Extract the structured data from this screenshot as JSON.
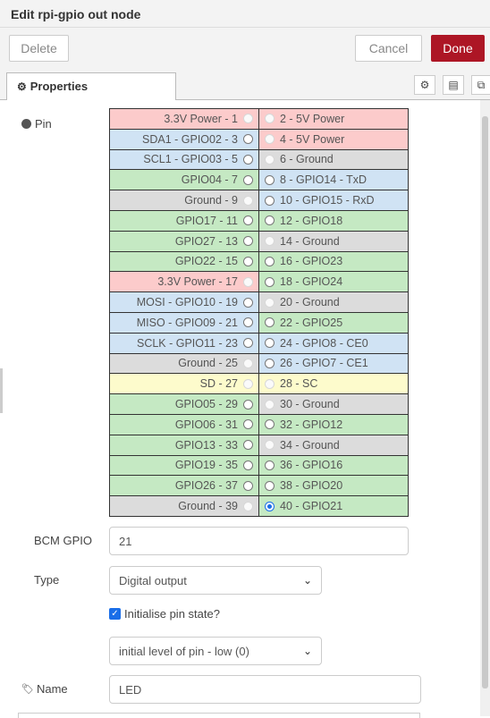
{
  "header": {
    "title": "Edit rpi-gpio out node"
  },
  "toolbar": {
    "delete_label": "Delete",
    "cancel_label": "Cancel",
    "done_label": "Done",
    "done_color": "#ad1625"
  },
  "tabs": {
    "properties_label": "Properties",
    "icons": [
      "gear-icon",
      "description-icon",
      "appearance-icon"
    ]
  },
  "form": {
    "pin_label": "Pin",
    "bcm_label": "BCM GPIO",
    "bcm_value": "21",
    "type_label": "Type",
    "type_value": "Digital output",
    "init_label": "Initialise pin state?",
    "init_checked": true,
    "level_value": "initial level of pin - low (0)",
    "name_label": "Name",
    "name_value": "LED"
  },
  "pins": [
    {
      "left": "3.3V Power - 1",
      "left_type": "power",
      "left_enabled": false,
      "right": "2 - 5V Power",
      "right_type": "power",
      "right_enabled": false
    },
    {
      "left": "SDA1 - GPIO02 - 3",
      "left_type": "i2c",
      "left_enabled": true,
      "right": "4 - 5V Power",
      "right_type": "power",
      "right_enabled": false
    },
    {
      "left": "SCL1 - GPIO03 - 5",
      "left_type": "i2c",
      "left_enabled": true,
      "right": "6 - Ground",
      "right_type": "ground",
      "right_enabled": false
    },
    {
      "left": "GPIO04 - 7",
      "left_type": "gpio",
      "left_enabled": true,
      "right": "8 - GPIO14 - TxD",
      "right_type": "uart",
      "right_enabled": true
    },
    {
      "left": "Ground - 9",
      "left_type": "ground",
      "left_enabled": false,
      "right": "10 - GPIO15 - RxD",
      "right_type": "uart",
      "right_enabled": true
    },
    {
      "left": "GPIO17 - 11",
      "left_type": "gpio",
      "left_enabled": true,
      "right": "12 - GPIO18",
      "right_type": "gpio",
      "right_enabled": true
    },
    {
      "left": "GPIO27 - 13",
      "left_type": "gpio",
      "left_enabled": true,
      "right": "14 - Ground",
      "right_type": "ground",
      "right_enabled": false
    },
    {
      "left": "GPIO22 - 15",
      "left_type": "gpio",
      "left_enabled": true,
      "right": "16 - GPIO23",
      "right_type": "gpio",
      "right_enabled": true
    },
    {
      "left": "3.3V Power - 17",
      "left_type": "power",
      "left_enabled": false,
      "right": "18 - GPIO24",
      "right_type": "gpio",
      "right_enabled": true
    },
    {
      "left": "MOSI - GPIO10 - 19",
      "left_type": "spi",
      "left_enabled": true,
      "right": "20 - Ground",
      "right_type": "ground",
      "right_enabled": false
    },
    {
      "left": "MISO - GPIO09 - 21",
      "left_type": "spi",
      "left_enabled": true,
      "right": "22 - GPIO25",
      "right_type": "gpio",
      "right_enabled": true
    },
    {
      "left": "SCLK - GPIO11 - 23",
      "left_type": "spi",
      "left_enabled": true,
      "right": "24 - GPIO8 - CE0",
      "right_type": "spi",
      "right_enabled": true
    },
    {
      "left": "Ground - 25",
      "left_type": "ground",
      "left_enabled": false,
      "right": "26 - GPIO7 - CE1",
      "right_type": "spi",
      "right_enabled": true
    },
    {
      "left": "SD - 27",
      "left_type": "sd",
      "left_enabled": false,
      "right": "28 - SC",
      "right_type": "sd",
      "right_enabled": false
    },
    {
      "left": "GPIO05 - 29",
      "left_type": "gpio",
      "left_enabled": true,
      "right": "30 - Ground",
      "right_type": "ground",
      "right_enabled": false
    },
    {
      "left": "GPIO06 - 31",
      "left_type": "gpio",
      "left_enabled": true,
      "right": "32 - GPIO12",
      "right_type": "gpio",
      "right_enabled": true
    },
    {
      "left": "GPIO13 - 33",
      "left_type": "gpio",
      "left_enabled": true,
      "right": "34 - Ground",
      "right_type": "ground",
      "right_enabled": false
    },
    {
      "left": "GPIO19 - 35",
      "left_type": "gpio",
      "left_enabled": true,
      "right": "36 - GPIO16",
      "right_type": "gpio",
      "right_enabled": true
    },
    {
      "left": "GPIO26 - 37",
      "left_type": "gpio",
      "left_enabled": true,
      "right": "38 - GPIO20",
      "right_type": "gpio",
      "right_enabled": true
    },
    {
      "left": "Ground - 39",
      "left_type": "ground",
      "left_enabled": false,
      "right": "40 - GPIO21",
      "right_type": "gpio",
      "right_enabled": true,
      "right_checked": true
    }
  ]
}
